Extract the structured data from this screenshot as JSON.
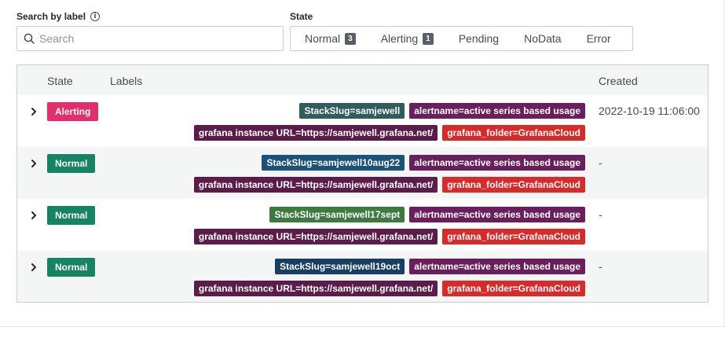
{
  "search": {
    "label": "Search by label",
    "info_icon": "info-icon",
    "placeholder": "Search",
    "value": ""
  },
  "state_filter": {
    "label": "State",
    "options": [
      {
        "label": "Normal",
        "count": "3"
      },
      {
        "label": "Alerting",
        "count": "1"
      },
      {
        "label": "Pending"
      },
      {
        "label": "NoData"
      },
      {
        "label": "Error"
      }
    ]
  },
  "table": {
    "headers": {
      "state": "State",
      "labels": "Labels",
      "created": "Created"
    },
    "rows": [
      {
        "state": "Alerting",
        "state_color": "#e02f6b",
        "labels": [
          [
            {
              "text": "StackSlug=samjewell",
              "color": "#2f5d5c"
            },
            {
              "text": "alertname=active series based usage",
              "color": "#6b1e5c"
            }
          ],
          [
            {
              "text": "grafana instance URL=https://samjewell.grafana.net/",
              "color": "#5b1c4a"
            },
            {
              "text": "grafana_folder=GrafanaCloud",
              "color": "#d92a2a"
            }
          ]
        ],
        "created": "2022-10-19 11:06:00"
      },
      {
        "state": "Normal",
        "state_color": "#168463",
        "labels": [
          [
            {
              "text": "StackSlug=samjewell10aug22",
              "color": "#1b527c"
            },
            {
              "text": "alertname=active series based usage",
              "color": "#6b1e5c"
            }
          ],
          [
            {
              "text": "grafana instance URL=https://samjewell.grafana.net/",
              "color": "#5b1c4a"
            },
            {
              "text": "grafana_folder=GrafanaCloud",
              "color": "#d92a2a"
            }
          ]
        ],
        "created": "-"
      },
      {
        "state": "Normal",
        "state_color": "#168463",
        "labels": [
          [
            {
              "text": "StackSlug=samjewell17sept",
              "color": "#3d7a3f"
            },
            {
              "text": "alertname=active series based usage",
              "color": "#6b1e5c"
            }
          ],
          [
            {
              "text": "grafana instance URL=https://samjewell.grafana.net/",
              "color": "#5b1c4a"
            },
            {
              "text": "grafana_folder=GrafanaCloud",
              "color": "#d92a2a"
            }
          ]
        ],
        "created": "-"
      },
      {
        "state": "Normal",
        "state_color": "#168463",
        "labels": [
          [
            {
              "text": "StackSlug=samjewell19oct",
              "color": "#183e63"
            },
            {
              "text": "alertname=active series based usage",
              "color": "#6b1e5c"
            }
          ],
          [
            {
              "text": "grafana instance URL=https://samjewell.grafana.net/",
              "color": "#5b1c4a"
            },
            {
              "text": "grafana_folder=GrafanaCloud",
              "color": "#d92a2a"
            }
          ]
        ],
        "created": "-"
      }
    ]
  }
}
